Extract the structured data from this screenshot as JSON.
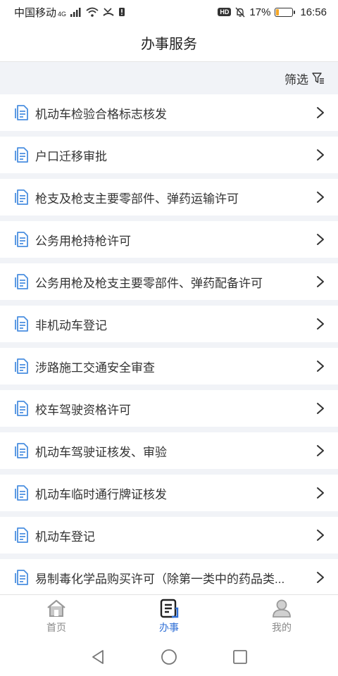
{
  "status_bar": {
    "carrier": "中国移动",
    "network": "4G",
    "battery_percent": "17%",
    "battery_level": 0.17,
    "time": "16:56",
    "hd": "HD"
  },
  "header": {
    "title": "办事服务"
  },
  "filter": {
    "label": "筛选",
    "icon": "filter-icon"
  },
  "services": [
    {
      "label": "机动车检验合格标志核发"
    },
    {
      "label": "户口迁移审批"
    },
    {
      "label": "枪支及枪支主要零部件、弹药运输许可"
    },
    {
      "label": "公务用枪持枪许可"
    },
    {
      "label": "公务用枪及枪支主要零部件、弹药配备许可"
    },
    {
      "label": "非机动车登记"
    },
    {
      "label": "涉路施工交通安全审查"
    },
    {
      "label": "校车驾驶资格许可"
    },
    {
      "label": "机动车驾驶证核发、审验"
    },
    {
      "label": "机动车临时通行牌证核发"
    },
    {
      "label": "机动车登记"
    },
    {
      "label": "易制毒化学品购买许可（除第一类中的药品类..."
    }
  ],
  "tabs": [
    {
      "label": "首页",
      "icon": "home-icon",
      "active": false
    },
    {
      "label": "办事",
      "icon": "document-icon",
      "active": true
    },
    {
      "label": "我的",
      "icon": "user-icon",
      "active": false
    }
  ],
  "colors": {
    "accent": "#2f6fd6",
    "list_icon": "#4a8fe0",
    "background": "#f1f3f7",
    "battery": "#f5a623"
  }
}
